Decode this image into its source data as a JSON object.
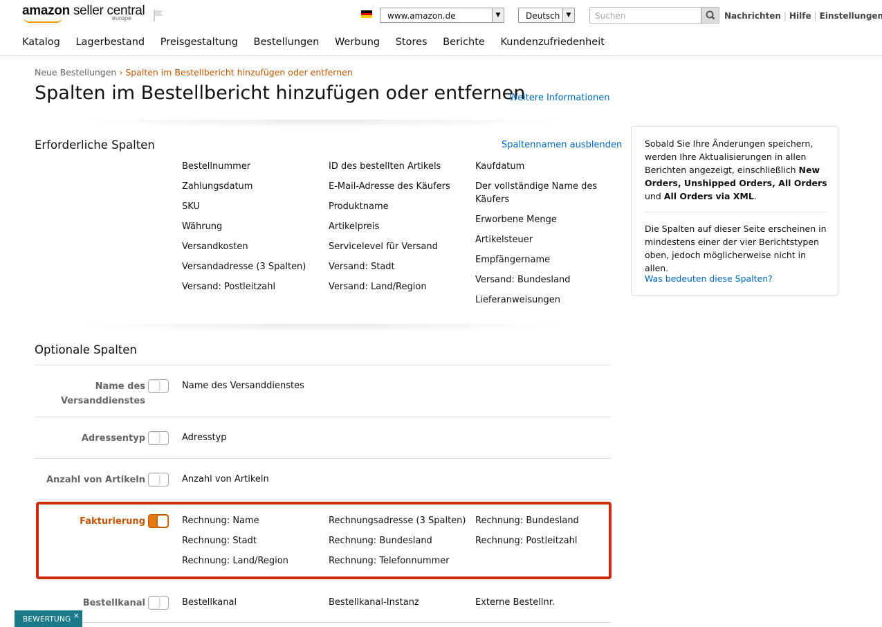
{
  "header": {
    "logo_brand": "amazon",
    "logo_product": "seller central",
    "logo_region": "europe",
    "marketplace": "www.amazon.de",
    "language": "Deutsch",
    "search_placeholder": "Suchen",
    "links": [
      "Nachrichten",
      "Hilfe",
      "Einstellungen"
    ]
  },
  "nav": [
    "Katalog",
    "Lagerbestand",
    "Preisgestaltung",
    "Bestellungen",
    "Werbung",
    "Stores",
    "Berichte",
    "Kundenzufriedenheit"
  ],
  "breadcrumb": {
    "parent": "Neue Bestellungen",
    "separator": "›",
    "current": "Spalten im Bestellbericht hinzufügen oder entfernen"
  },
  "page_title": "Spalten im Bestellbericht hinzufügen oder entfernen",
  "more_info_link": "Weitere Informationen",
  "required": {
    "heading": "Erforderliche Spalten",
    "toggle_names_link": "Spaltennamen ausblenden",
    "columns": [
      [
        "Bestellnummer",
        "Zahlungsdatum",
        "SKU",
        "Währung",
        "Versandkosten",
        "Versandadresse (3 Spalten)",
        "Versand: Postleitzahl"
      ],
      [
        "ID des bestellten Artikels",
        "E-Mail-Adresse des Käufers",
        "Produktname",
        "Artikelpreis",
        "Servicelevel für Versand",
        "Versand: Stadt",
        "Versand: Land/Region"
      ],
      [
        "Kaufdatum",
        "Der vollständige Name des Käufers",
        "Erworbene Menge",
        "Artikelsteuer",
        "Empfängername",
        "Versand: Bundesland",
        "Lieferanweisungen"
      ]
    ]
  },
  "optional": {
    "heading": "Optionale Spalten",
    "groups": [
      {
        "label": "Name des Versanddienstes",
        "enabled": false,
        "fields": [
          "Name des Versanddienstes"
        ]
      },
      {
        "label": "Adressentyp",
        "enabled": false,
        "fields": [
          "Adresstyp"
        ]
      },
      {
        "label": "Anzahl von Artikeln",
        "enabled": false,
        "fields": [
          "Anzahl von Artikeln"
        ]
      },
      {
        "label": "Fakturierung",
        "enabled": true,
        "fields": [
          "Rechnung: Name",
          "Rechnungsadresse (3 Spalten)",
          "Rechnung: Bundesland",
          "Rechnung: Stadt",
          "Rechnung: Bundesland",
          "Rechnung: Postleitzahl",
          "Rechnung: Land/Region",
          "Rechnung: Telefonnummer"
        ]
      },
      {
        "label": "Bestellkanal",
        "enabled": false,
        "fields": [
          "Bestellkanal",
          "Bestellkanal-Instanz",
          "Externe Bestellnr."
        ]
      }
    ]
  },
  "sidebar": {
    "p1_pre": "Sobald Sie Ihre Änderungen speichern, werden Ihre Aktualisierungen in allen Berichten angezeigt, einschließlich ",
    "p1_bold1": "New Orders, Unshipped Orders, All Orders",
    "p1_mid": " und ",
    "p1_bold2": "All Orders via XML",
    "p1_end": ".",
    "p2": "Die Spalten auf dieser Seite erscheinen in mindestens einer der vier Berichtstypen oben, jedoch möglicherweise nicht in allen.",
    "link": "Was bedeuten diese Spalten?"
  },
  "feedback": {
    "label": "BEWERTUNG",
    "close": "×"
  },
  "colors": {
    "accent": "#c45500",
    "toggle_on": "#e47911",
    "link": "#0066c0",
    "highlight_border": "#cc2b0c",
    "feedback_bg": "#1b7a8a"
  }
}
